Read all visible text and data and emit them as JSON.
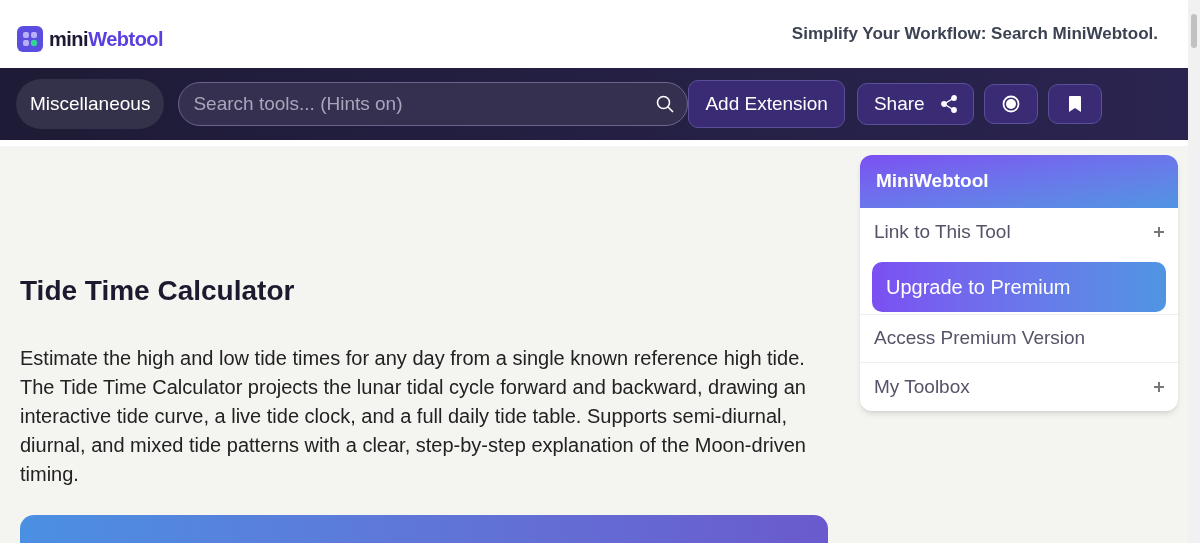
{
  "header": {
    "logo": {
      "prefix": "mini",
      "suffix": "Webtool"
    },
    "tagline": "Simplify Your Workflow: Search MiniWebtool."
  },
  "navbar": {
    "category": "Miscellaneous",
    "search": {
      "placeholder": "Search tools... (Hints on)"
    },
    "buttons": [
      {
        "kind": "text",
        "label": "Add Extension"
      },
      {
        "kind": "share",
        "label": "Share"
      },
      {
        "kind": "record"
      },
      {
        "kind": "bookmark"
      }
    ]
  },
  "main": {
    "title": "Tide Time Calculator",
    "description": "Estimate the high and low tide times for any day from a single known reference high tide. The Tide Time Calculator projects the lunar tidal cycle forward and backward, drawing an interactive tide curve, a live tide clock, and a full daily tide table. Supports semi-diurnal, diurnal, and mixed tide patterns with a clear, step-by-step explanation of the Moon-driven timing."
  },
  "sidebar": {
    "title": "MiniWebtool",
    "items": [
      {
        "kind": "expand",
        "label": "Link to This Tool"
      },
      {
        "kind": "premium",
        "label": "Upgrade to Premium"
      },
      {
        "kind": "plain",
        "label": "Access Premium Version"
      },
      {
        "kind": "expand",
        "label": "My Toolbox"
      }
    ]
  }
}
